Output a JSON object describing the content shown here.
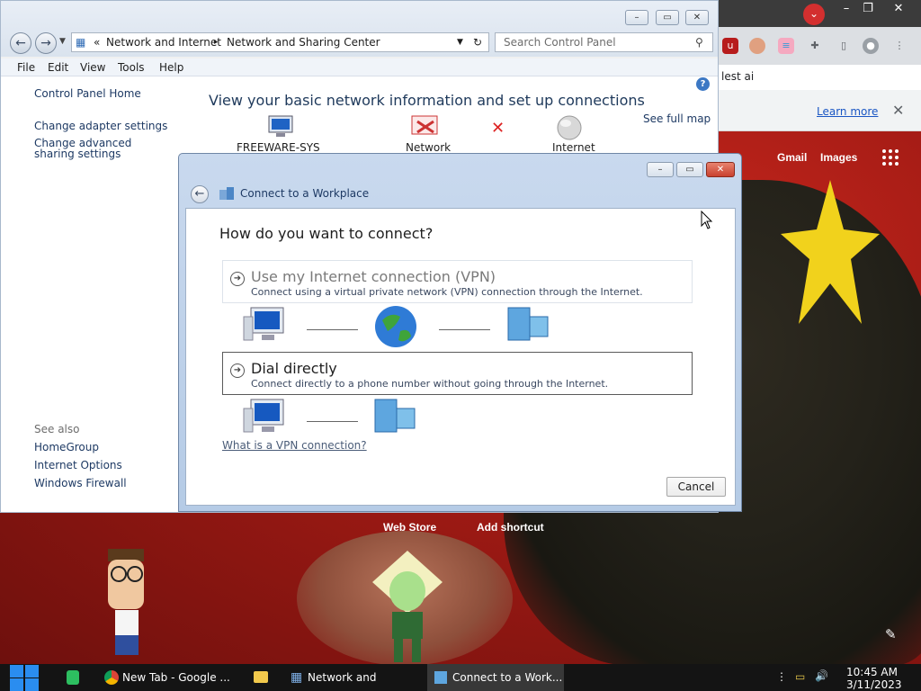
{
  "chrome": {
    "omnibox_text": "lest ai",
    "infobar_link": "Learn more",
    "ntp_links": {
      "gmail": "Gmail",
      "images": "Images"
    },
    "shortcuts": {
      "web_store": "Web Store",
      "add_shortcut": "Add shortcut"
    }
  },
  "control_panel": {
    "address": {
      "prefix": "«",
      "crumb1": "Network and Internet",
      "crumb2": "Network and Sharing Center"
    },
    "search_placeholder": "Search Control Panel",
    "menu": [
      "File",
      "Edit",
      "View",
      "Tools",
      "Help"
    ],
    "left_pane": {
      "home": "Control Panel Home",
      "adapter": "Change adapter settings",
      "sharing": "Change advanced sharing settings",
      "see_also": "See also",
      "homegroup": "HomeGroup",
      "internet_options": "Internet Options",
      "firewall": "Windows Firewall"
    },
    "heading": "View your basic network information and set up connections",
    "see_full_map": "See full map",
    "map": {
      "computer": "FREEWARE-SYS",
      "network": "Network",
      "internet": "Internet"
    }
  },
  "workplace_dialog": {
    "title": "Connect to a Workplace",
    "question": "How do you want to connect?",
    "vpn_option": {
      "title": "Use my Internet connection (VPN)",
      "description": "Connect using a virtual private network (VPN) connection through the Internet."
    },
    "dial_option": {
      "title": "Dial directly",
      "description": "Connect directly to a phone number without going through the Internet."
    },
    "help_link": "What is a VPN connection?",
    "cancel": "Cancel"
  },
  "taskbar": {
    "items": [
      {
        "label": "New Tab - Google ..."
      },
      {
        "label": "Network and Sharin..."
      },
      {
        "label": "Connect to a Work..."
      }
    ],
    "time": "10:45 AM",
    "date": "3/11/2023"
  },
  "icons": {
    "start": "windows-logo-icon",
    "chrome": "chrome-icon",
    "explorer": "folder-icon",
    "volume": "speaker-icon",
    "network": "network-tray-icon",
    "close_dialog_color": "#c9412f",
    "dialog_chrome_color": "#c5d6ec"
  }
}
